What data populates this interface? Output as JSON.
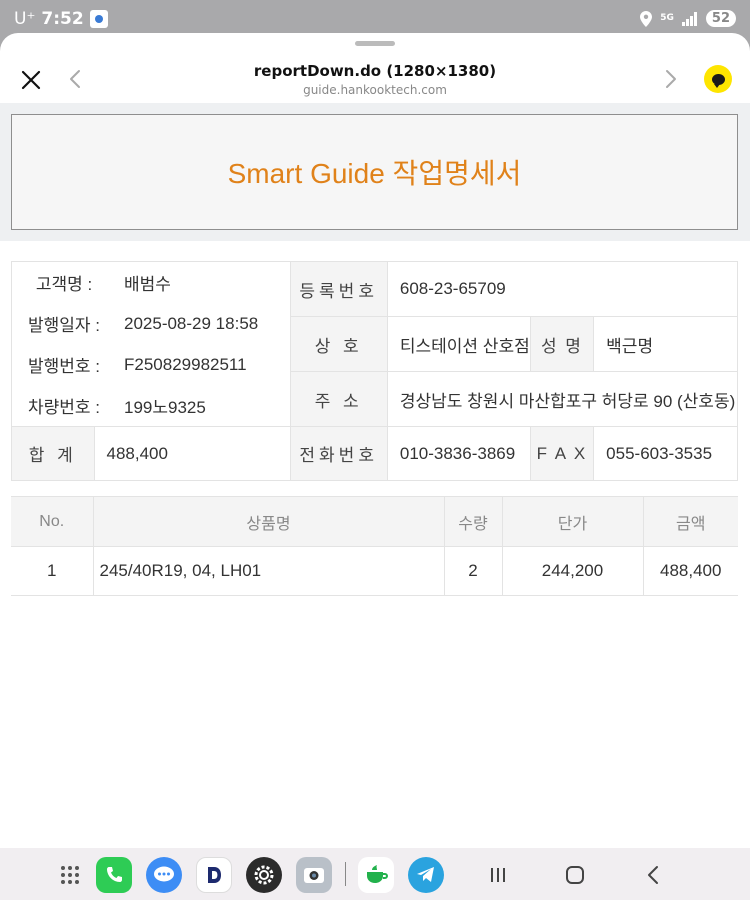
{
  "status_bar": {
    "carrier": "U⁺",
    "time": "7:52",
    "battery": "52",
    "network": "5G"
  },
  "browser": {
    "title": "reportDown.do (1280×1380)",
    "url": "guide.hankooktech.com"
  },
  "header": {
    "title": "Smart Guide 작업명세서"
  },
  "customer": {
    "name_label": "고객명 :",
    "name": "배범수",
    "date_label": "발행일자 :",
    "date": "2025-08-29 18:58",
    "number_label": "발행번호 :",
    "number": "F250829982511",
    "car_label": "차량번호 :",
    "car": "199노9325"
  },
  "total": {
    "label": "합 계",
    "value": "488,400"
  },
  "business": {
    "reg_label": "등록번호",
    "reg": "608-23-65709",
    "company_label": "상 호",
    "company": "티스테이션 산호점",
    "owner_label": "성 명",
    "owner": "백근명",
    "address_label": "주 소",
    "address": "경상남도 창원시 마산합포구 허당로 90 (산호동)",
    "phone_label": "전화번호",
    "phone": "010-3836-3869",
    "fax_label": "F A X",
    "fax": "055-603-3535"
  },
  "items": {
    "headers": [
      "No.",
      "상품명",
      "수량",
      "단가",
      "금액"
    ],
    "rows": [
      {
        "no": "1",
        "name": "245/40R19, 04, LH01",
        "qty": "2",
        "price": "244,200",
        "amount": "488,400"
      }
    ]
  },
  "colors": {
    "accent": "#e0821a",
    "kakao": "#fee500"
  }
}
